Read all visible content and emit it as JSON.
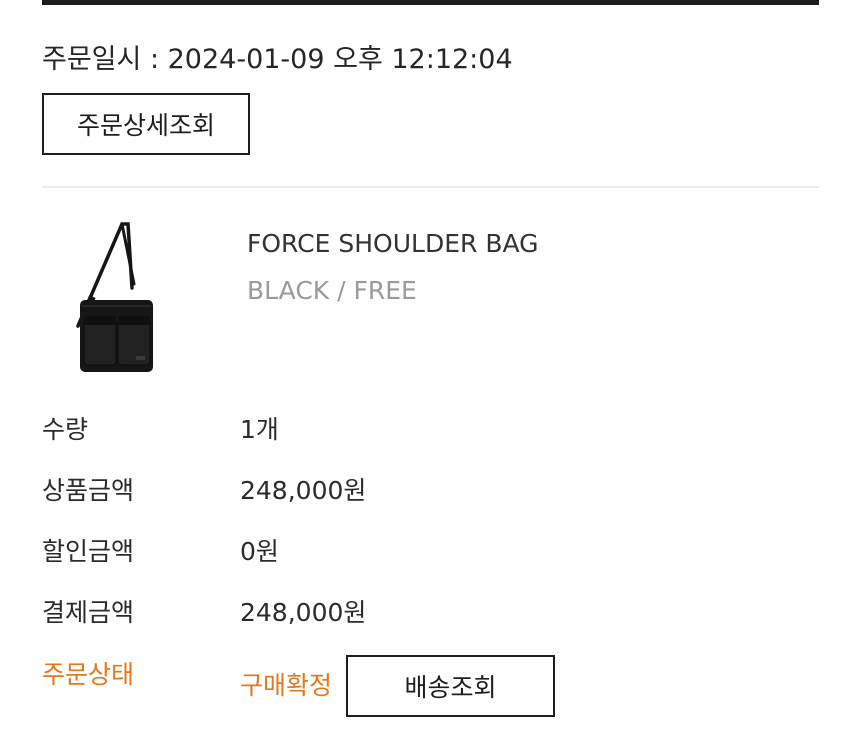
{
  "order": {
    "date_text": "주문일시 : 2024-01-09 오후 12:12:04",
    "detail_button": "주문상세조회"
  },
  "product": {
    "name": "FORCE SHOULDER BAG",
    "option": "BLACK / FREE",
    "image_icon": "shoulder-bag-icon"
  },
  "summary": [
    {
      "label": "수량",
      "value": "1개"
    },
    {
      "label": "상품금액",
      "value": "248,000원"
    },
    {
      "label": "할인금액",
      "value": "0원"
    },
    {
      "label": "결제금액",
      "value": "248,000원"
    }
  ],
  "status": {
    "label": "주문상태",
    "value": "구매확정",
    "track_button": "배송조회",
    "accent_color": "#e4781c"
  }
}
